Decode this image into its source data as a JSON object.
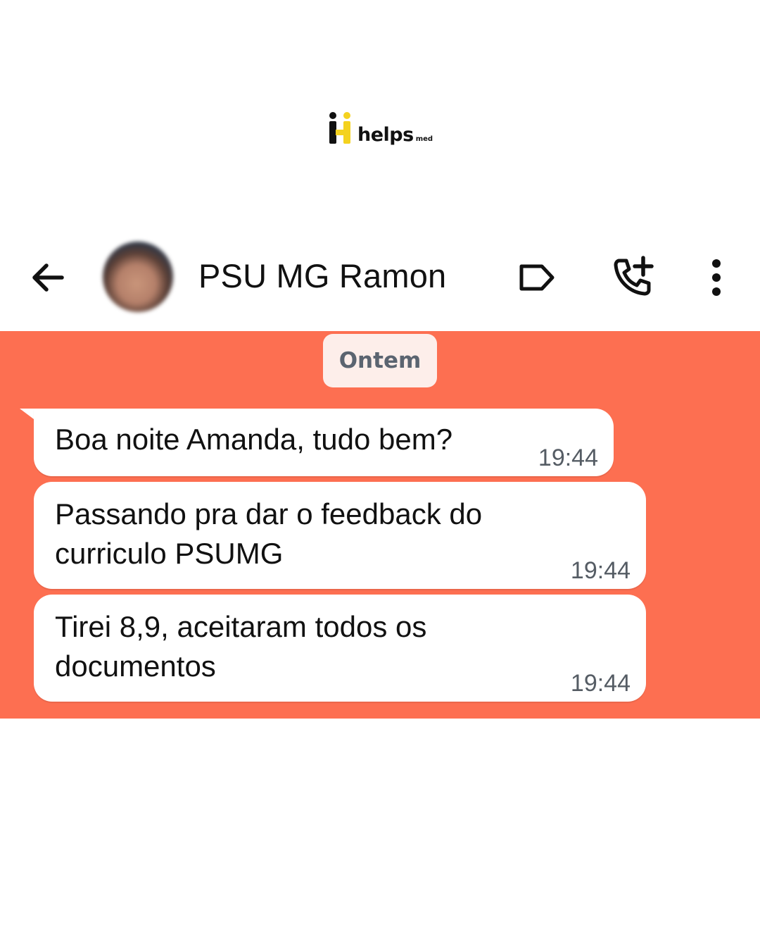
{
  "brand": {
    "name": "helps",
    "suffix": "med"
  },
  "header": {
    "contact_name": "PSU MG Ramon",
    "icons": [
      "back-arrow-icon",
      "avatar",
      "label-tag-icon",
      "add-call-icon",
      "more-vert-icon"
    ]
  },
  "chat": {
    "date_chip": "Ontem",
    "messages": [
      {
        "text": "Boa noite Amanda, tudo bem?",
        "time": "19:44"
      },
      {
        "text": "Passando pra dar o feedback do curriculo PSUMG",
        "time": "19:44"
      },
      {
        "text": "Tirei 8,9, aceitaram todos os documentos",
        "time": "19:44"
      }
    ]
  },
  "colors": {
    "chat_background": "#fd6f51",
    "bubble": "#ffffff",
    "date_chip": "#fdeeea",
    "brand_accent": "#f4d21f"
  }
}
